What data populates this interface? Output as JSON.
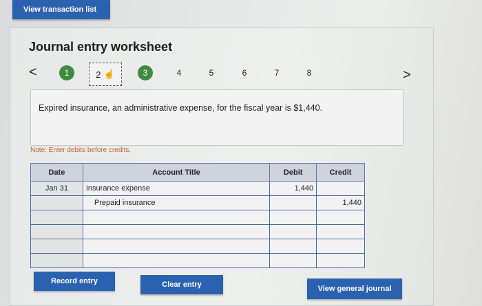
{
  "top_bar": {
    "view_transaction_list": "View transaction list"
  },
  "worksheet": {
    "title": "Journal entry worksheet",
    "prev_arrow": "<",
    "next_arrow": ">",
    "steps": [
      "1",
      "2",
      "3",
      "4",
      "5",
      "6",
      "7",
      "8"
    ],
    "current_step": "2",
    "completed_steps": [
      "1",
      "3"
    ],
    "question": "Expired insurance, an administrative expense, for the fiscal year is $1,440.",
    "note": "Note: Enter debits before credits."
  },
  "journal_table": {
    "headers": {
      "date": "Date",
      "account": "Account Title",
      "debit": "Debit",
      "credit": "Credit"
    },
    "rows": [
      {
        "date": "Jan 31",
        "account": "Insurance expense",
        "debit": "1,440",
        "credit": ""
      },
      {
        "date": "",
        "account": "Prepaid insurance",
        "debit": "",
        "credit": "1,440"
      },
      {
        "date": "",
        "account": "",
        "debit": "",
        "credit": ""
      },
      {
        "date": "",
        "account": "",
        "debit": "",
        "credit": ""
      },
      {
        "date": "",
        "account": "",
        "debit": "",
        "credit": ""
      },
      {
        "date": "",
        "account": "",
        "debit": "",
        "credit": ""
      }
    ]
  },
  "actions": {
    "record_entry": "Record entry",
    "clear_entry": "Clear entry",
    "view_general_journal": "View general journal"
  },
  "colors": {
    "button_blue": "#2b62b0",
    "step_done_green": "#3d8b3d",
    "note_orange": "#c4602a",
    "table_border": "#4a6aa8"
  }
}
